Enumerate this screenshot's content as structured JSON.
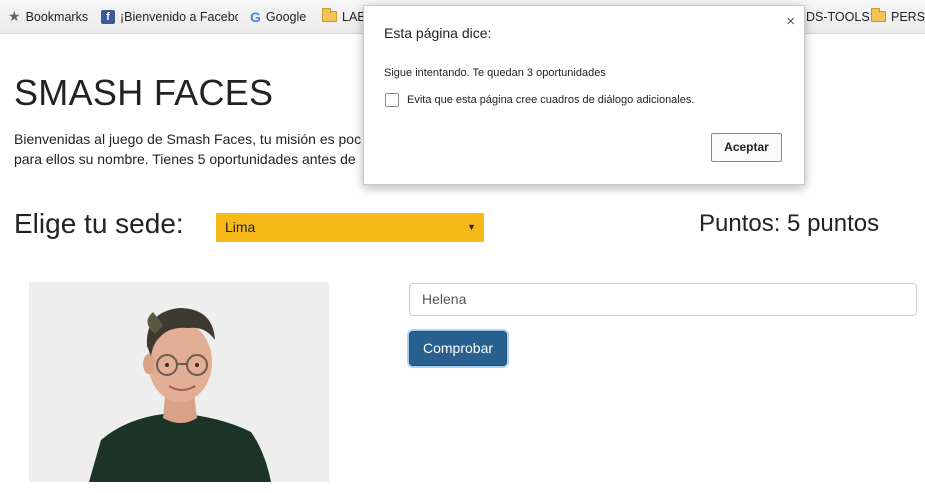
{
  "bookmarks_bar": {
    "items": [
      {
        "label": "Bookmarks",
        "icon": "star-icon"
      },
      {
        "label": "¡Bienvenido a Facebo",
        "icon": "facebook-icon"
      },
      {
        "label": "Google",
        "icon": "google-icon"
      },
      {
        "label": "LAB",
        "icon": "folder-icon"
      },
      {
        "label": "DS-TOOLS",
        "icon": "folder-icon"
      },
      {
        "label": "PERSO",
        "icon": "folder-icon"
      }
    ]
  },
  "page": {
    "title": "SMASH FACES",
    "intro_line1": "Bienvenidas al juego de Smash Faces, tu misión es poc",
    "intro_line2": "para ellos su nombre. Tienes 5 oportunidades antes de",
    "sede_label": "Elige tu sede:",
    "sede_selected": "Lima",
    "puntos": "Puntos: 5 puntos",
    "name_value": "Helena",
    "check_button": "Comprobar"
  },
  "dialog": {
    "title": "Esta página dice:",
    "message": "Sigue intentando. Te quedan 3 oportunidades",
    "checkbox_label": "Evita que esta página cree cuadros de diálogo adicionales.",
    "ok_label": "Aceptar",
    "close_glyph": "×"
  },
  "colors": {
    "select_bg": "#f7b918",
    "button_bg": "#286090"
  }
}
